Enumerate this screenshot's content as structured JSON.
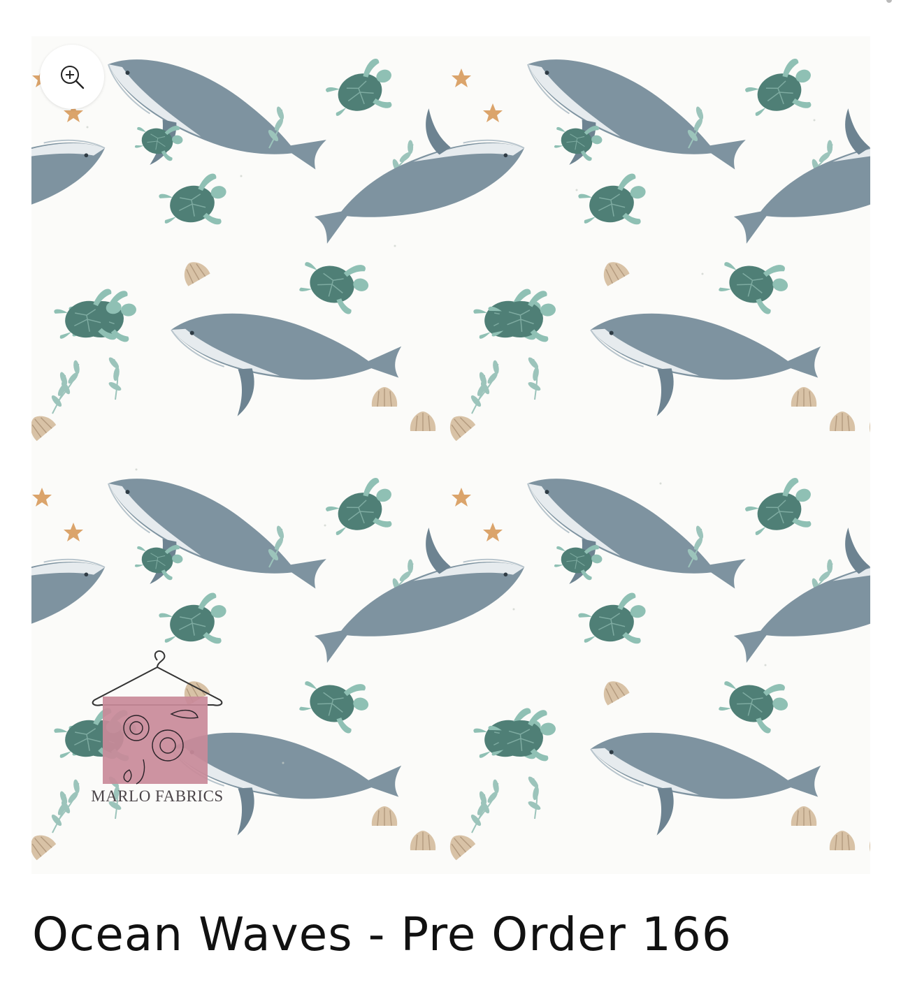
{
  "product": {
    "title": "Ocean Waves - Pre Order 166",
    "watermark": {
      "brand_text": "MARLO FABRICS",
      "swatch_color": "#c98a99"
    },
    "zoom_icon": "zoom-in-icon",
    "pattern_colors": {
      "background": "#fbfbf9",
      "whale": "#7e93a0",
      "whale_belly": "#e6ebee",
      "turtle": "#4f7f76",
      "turtle_flipper": "#8fc0b4",
      "starfish": "#dba46b",
      "shell": "#d8c2a6",
      "leaf": "#9cc4bb"
    }
  }
}
